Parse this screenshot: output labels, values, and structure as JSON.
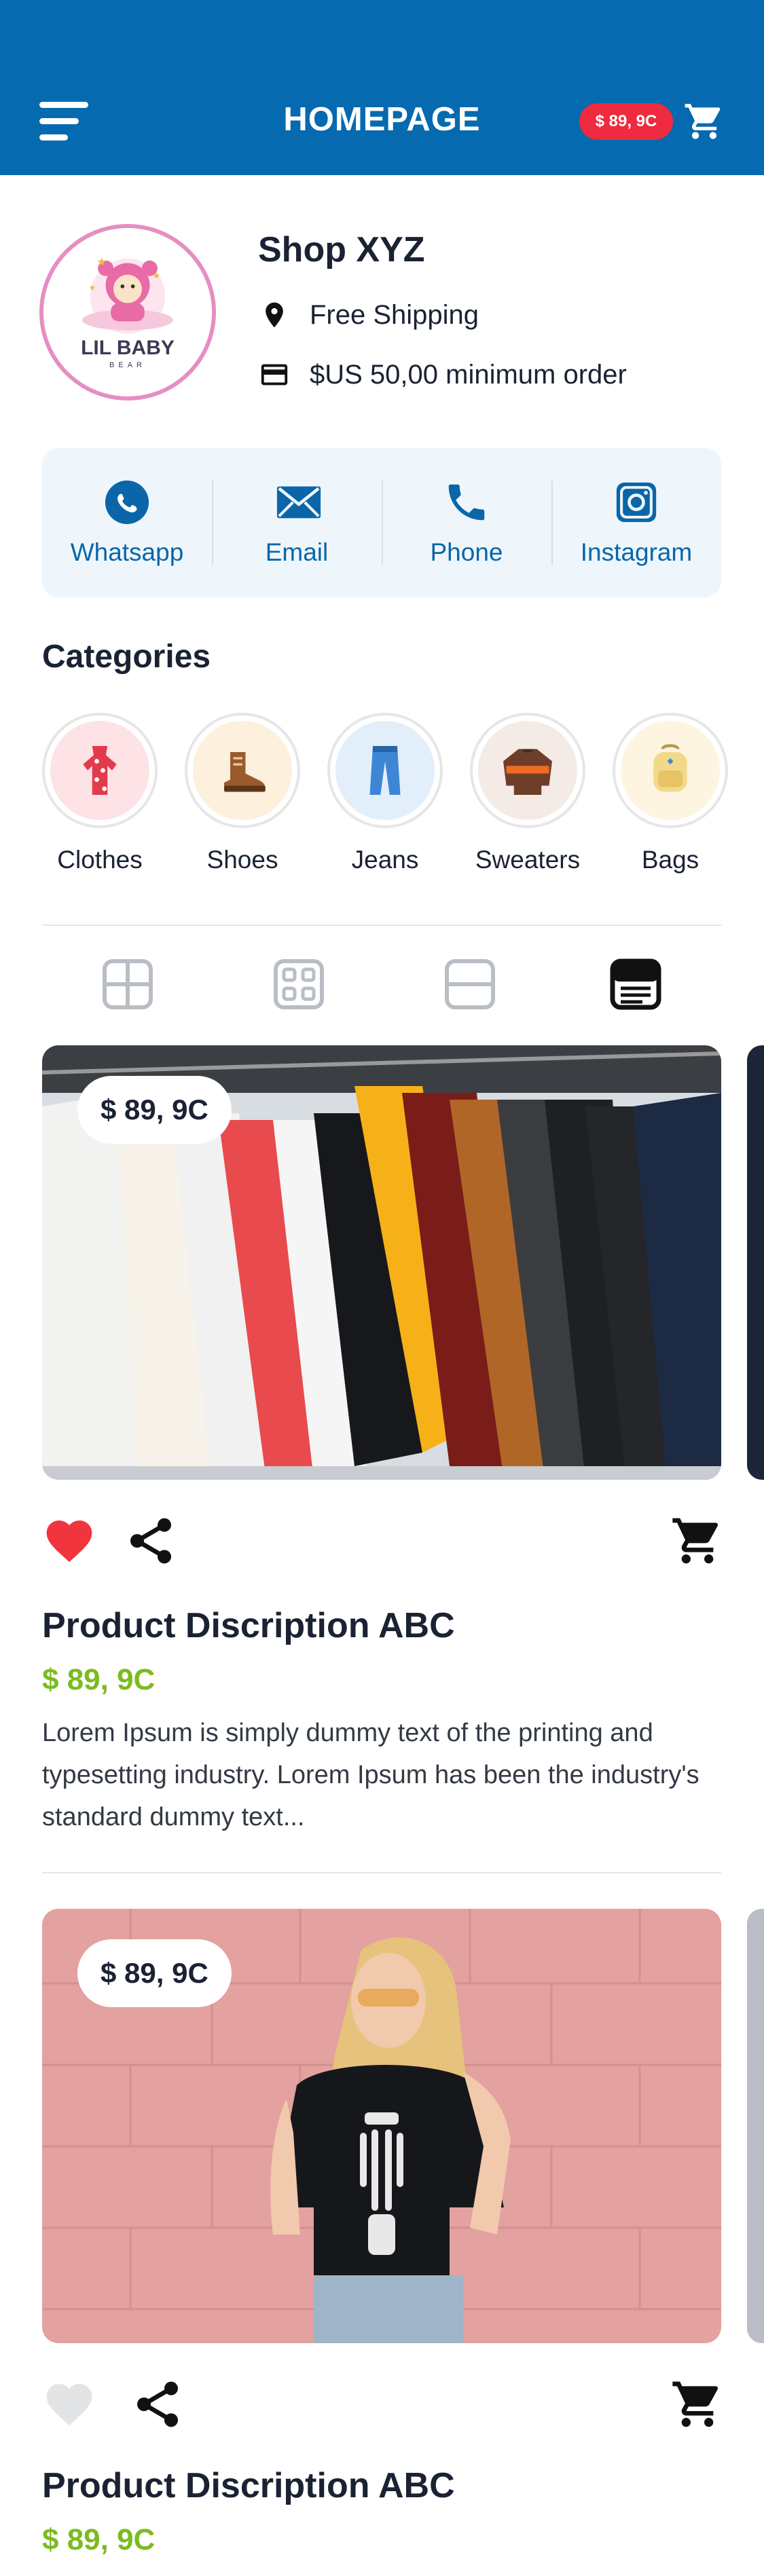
{
  "header": {
    "title": "HOMEPAGE",
    "cart_total": "$ 89, 9C",
    "menu_icon": "hamburger-menu-icon",
    "cart_icon": "shopping-cart-icon",
    "background": "#056aaf"
  },
  "shop": {
    "name": "Shop XYZ",
    "logo_text": "LIL BABY",
    "logo_subtext": "BEAR",
    "shipping": "Free Shipping",
    "minimum_order": "$US 50,00 minimum order"
  },
  "contacts": [
    {
      "label": "Whatsapp",
      "icon": "whatsapp-icon"
    },
    {
      "label": "Email",
      "icon": "email-icon"
    },
    {
      "label": "Phone",
      "icon": "phone-icon"
    },
    {
      "label": "Instagram",
      "icon": "instagram-icon"
    }
  ],
  "categories": {
    "title": "Categories",
    "items": [
      {
        "label": "Clothes",
        "icon": "dress-icon"
      },
      {
        "label": "Shoes",
        "icon": "boot-icon"
      },
      {
        "label": "Jeans",
        "icon": "jeans-icon"
      },
      {
        "label": "Sweaters",
        "icon": "sweater-icon"
      },
      {
        "label": "Bags",
        "icon": "backpack-icon"
      }
    ]
  },
  "view_modes": [
    {
      "name": "grid-large",
      "active": false
    },
    {
      "name": "grid-small",
      "active": false
    },
    {
      "name": "rows",
      "active": false
    },
    {
      "name": "list-detail",
      "active": true
    }
  ],
  "products": [
    {
      "price_tag": "$ 89, 9C",
      "title": "Product Discription ABC",
      "price": "$ 89, 9C",
      "description": "Lorem Ipsum is simply dummy text of the printing and typesetting industry. Lorem Ipsum has been the industry's standard dummy text...",
      "liked": true
    },
    {
      "price_tag": "$ 89, 9C",
      "title": "Product Discription ABC",
      "price": "$ 89, 9C",
      "liked": false
    }
  ],
  "colors": {
    "primary": "#056aaf",
    "badge": "#ee2b3f",
    "price": "#7cbb1f",
    "like": "#f0353f"
  }
}
